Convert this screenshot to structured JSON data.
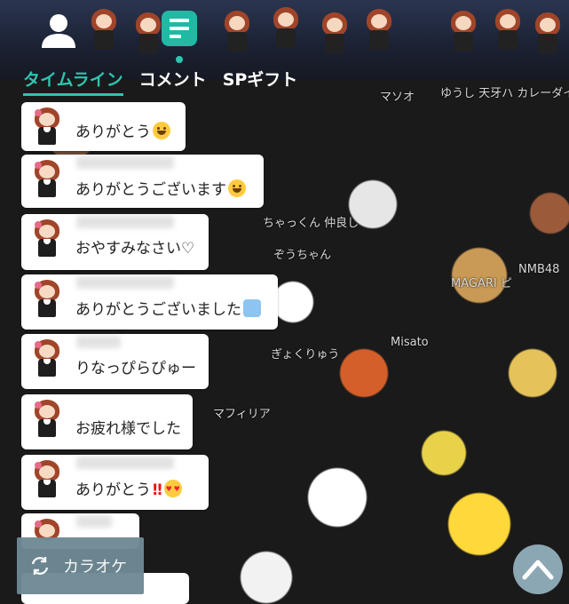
{
  "header": {
    "icons": {
      "user": "user-icon",
      "timeline_toggle": "timeline-toggle-icon"
    },
    "tabs": [
      {
        "label": "タイムライン",
        "active": true
      },
      {
        "label": "コメント",
        "active": false
      },
      {
        "label": "SPギフト",
        "active": false
      }
    ]
  },
  "messages": [
    {
      "text": "ありがとう",
      "emoji": [
        "smiling-face-icon"
      ]
    },
    {
      "text": "ありがとうございます",
      "emoji": [
        "smiling-face-icon"
      ]
    },
    {
      "text": "おやすみなさい♡",
      "emoji": []
    },
    {
      "text": "ありがとうございました",
      "emoji": [
        "woman-raising-hand-icon"
      ]
    },
    {
      "text": "りなっぴらぴゅー",
      "emoji": []
    },
    {
      "text": "お疲れ様でした",
      "emoji": []
    },
    {
      "text": "ありがとう",
      "emoji": [
        "double-exclamation-icon",
        "heart-eyes-icon"
      ]
    }
  ],
  "background_names": [
    "マソオ",
    "ゆうし 天牙ハ カレーダイス",
    "NMB48",
    "MAGARI ピ",
    "Misato",
    "ぎょくりゅう",
    "ぞうちゃん",
    "ちゃっくん 仲良し",
    "マフィリア"
  ],
  "karaoke_button": {
    "label": "カラオケ",
    "icon": "refresh-icon"
  },
  "scroll_top_button": {
    "icon": "chevron-up-icon"
  },
  "colors": {
    "accent": "#2ec4b0",
    "bubble": "#ffffff",
    "karaoke_bg": "#6f8a95",
    "scroll_btn_bg": "#8ba7b3"
  }
}
